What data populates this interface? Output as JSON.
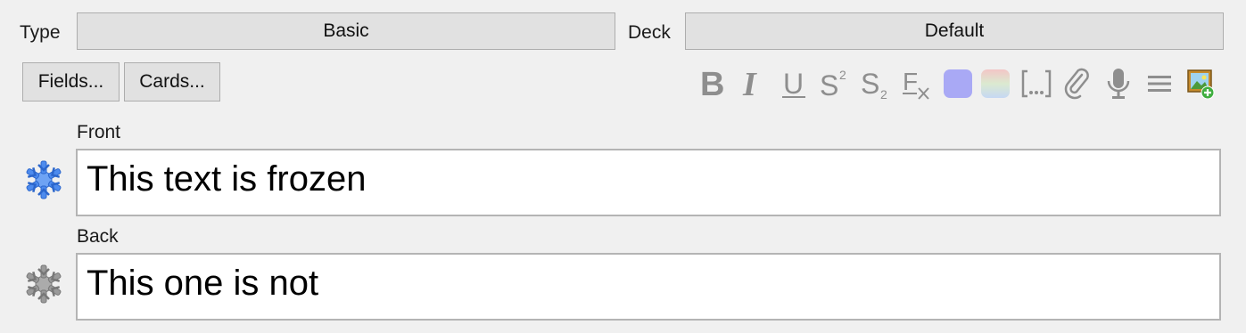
{
  "header": {
    "type_label": "Type",
    "type_value": "Basic",
    "deck_label": "Deck",
    "deck_value": "Default"
  },
  "buttons": {
    "fields_label": "Fields...",
    "cards_label": "Cards..."
  },
  "toolbar": {
    "icons": [
      "bold-icon",
      "italic-icon",
      "underline-icon",
      "superscript-icon",
      "subscript-icon",
      "clear-format-icon",
      "text-color-icon",
      "highlight-color-icon",
      "cloze-icon",
      "attach-icon",
      "record-audio-icon",
      "more-icon",
      "add-image-icon"
    ],
    "text_color": "#a9a9f5"
  },
  "fields": [
    {
      "label": "Front",
      "content": "This text is frozen",
      "frozen": true,
      "frozen_color": "#3b7be8"
    },
    {
      "label": "Back",
      "content": "This one is not",
      "frozen": false,
      "unfrozen_color": "#8a8a8a"
    }
  ]
}
